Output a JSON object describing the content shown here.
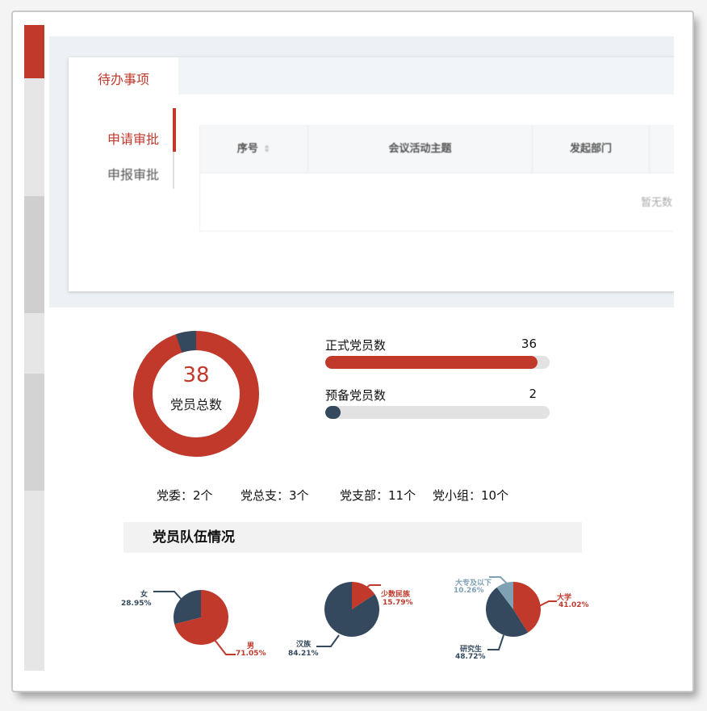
{
  "todo": {
    "title": "待办事项",
    "side_tabs": [
      "申请审批",
      "申报审批"
    ],
    "table_headers": [
      "序号",
      "会议活动主题",
      "发起部门"
    ],
    "empty_text": "暂无数"
  },
  "members": {
    "total": "38",
    "total_label": "党员总数",
    "bars": [
      {
        "label": "正式党员数",
        "value": "36",
        "fraction": 0.9474,
        "color": "#c0392b"
      },
      {
        "label": "预备党员数",
        "value": "2",
        "fraction": 0.0526,
        "color": "#34495e"
      }
    ]
  },
  "org_stats": [
    "党委：2个",
    "党总支：3个",
    "党支部：11个",
    "党小组：10个"
  ],
  "section": {
    "title": "党员队伍情况"
  },
  "colors": {
    "accent": "#c0392b",
    "dark": "#34495e",
    "light_blue": "#7fa1b4"
  },
  "chart_data": [
    {
      "type": "pie",
      "categories": [
        "男",
        "女"
      ],
      "values": [
        71.05,
        28.95
      ],
      "labels": [
        "71.05%",
        "28.95%"
      ]
    },
    {
      "type": "pie",
      "categories": [
        "少数民族",
        "汉族"
      ],
      "values": [
        15.79,
        84.21
      ],
      "labels": [
        "15.79%",
        "84.21%"
      ]
    },
    {
      "type": "pie",
      "categories": [
        "大学",
        "研究生",
        "大专及以下"
      ],
      "values": [
        41.02,
        48.72,
        10.26
      ],
      "labels": [
        "41.02%",
        "48.72%",
        "10.26%"
      ]
    }
  ]
}
